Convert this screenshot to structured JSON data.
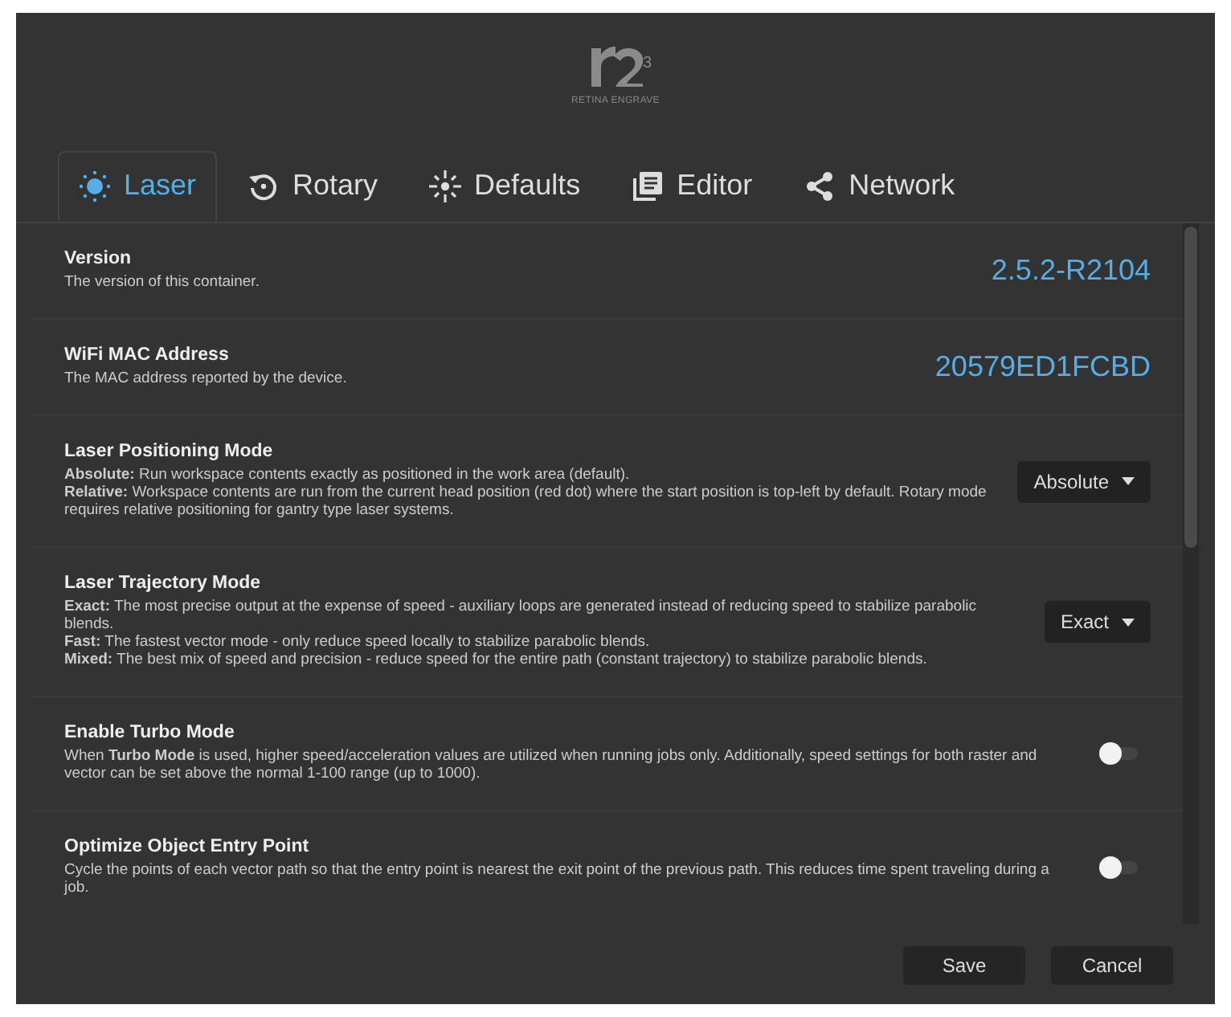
{
  "logo": {
    "superscript": "3",
    "caption": "RETINA ENGRAVE"
  },
  "tabs": [
    {
      "label": "Laser",
      "kind": "sun",
      "selected": true
    },
    {
      "label": "Rotary",
      "kind": "rotate",
      "selected": false
    },
    {
      "label": "Defaults",
      "kind": "spark",
      "selected": false
    },
    {
      "label": "Editor",
      "kind": "doc",
      "selected": false
    },
    {
      "label": "Network",
      "kind": "share",
      "selected": false
    }
  ],
  "settings": [
    {
      "kind": "value",
      "title": "Version",
      "description": [
        "The version of this container."
      ],
      "value": "2.5.2-R2104"
    },
    {
      "kind": "value",
      "title": "WiFi MAC Address",
      "description": [
        "The MAC address reported by the device."
      ],
      "value": "20579ED1FCBD"
    },
    {
      "kind": "select",
      "title": "Laser Positioning Mode",
      "description": [
        "**Absolute:** Run workspace contents exactly as positioned in the work area (default).",
        "**Relative:** Workspace contents are run from the current head position (red dot) where the start position is top-left by default. Rotary mode requires relative positioning for gantry type laser systems."
      ],
      "value": "Absolute"
    },
    {
      "kind": "select",
      "title": "Laser Trajectory Mode",
      "description": [
        "**Exact:** The most precise output at the expense of speed - auxiliary loops are generated instead of reducing speed to stabilize parabolic blends.",
        "**Fast:** The fastest vector mode - only reduce speed locally to stabilize parabolic blends.",
        "**Mixed:** The best mix of speed and precision - reduce speed for the entire path (constant trajectory) to stabilize parabolic blends."
      ],
      "value": "Exact"
    },
    {
      "kind": "toggle",
      "title": "Enable Turbo Mode",
      "description": [
        "When **Turbo Mode** is used, higher speed/acceleration values are utilized when running jobs only. Additionally, speed settings for both raster and vector can be set above the normal 1-100 range (up to 1000)."
      ],
      "on": false
    },
    {
      "kind": "toggle",
      "title": "Optimize Object Entry Point",
      "description": [
        "Cycle the points of each vector path so that the entry point is nearest the exit point of the previous path. This reduces time spent traveling during a job."
      ],
      "on": false
    }
  ],
  "buttons": [
    "Save",
    "Cancel"
  ]
}
